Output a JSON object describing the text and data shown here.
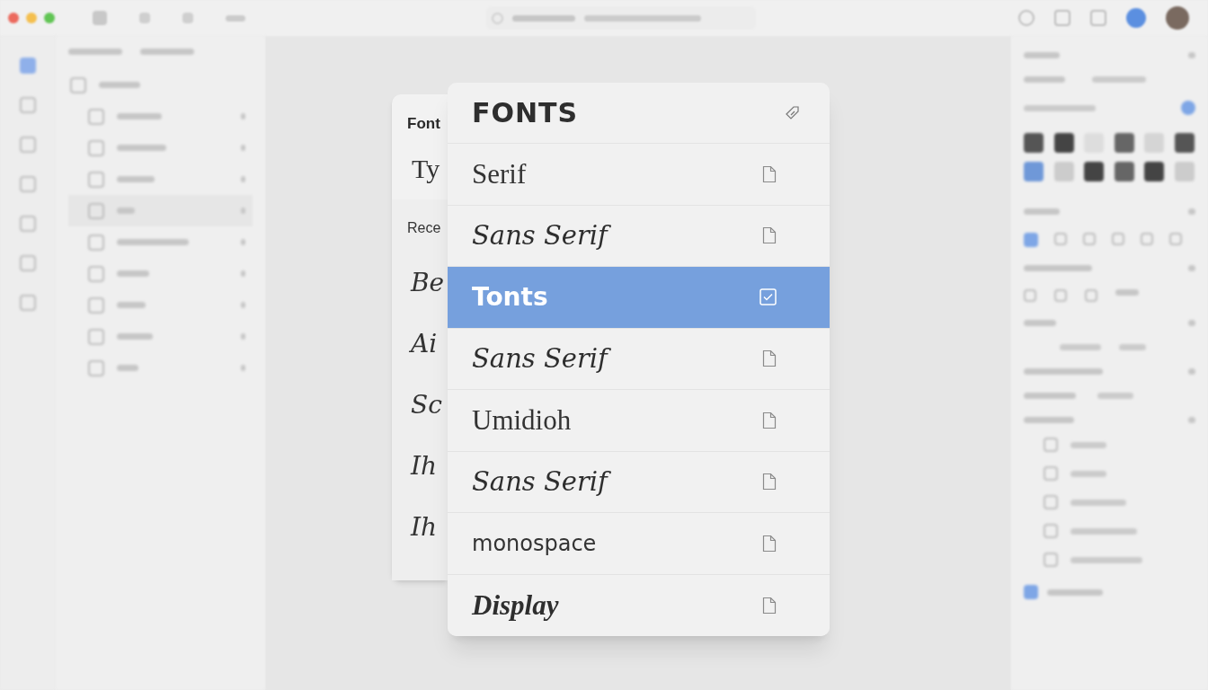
{
  "back_panel": {
    "title": "Font",
    "preview": "Ty",
    "section": "Rece",
    "samples": [
      "Be",
      "Ai",
      "Sc",
      "Ih",
      "Ih"
    ]
  },
  "font_menu": {
    "title": "FONTS",
    "items": [
      {
        "label": "Serif",
        "kind": "serif",
        "selected": false
      },
      {
        "label": "Sans Serif",
        "kind": "italic",
        "selected": false
      },
      {
        "label": "Tonts",
        "kind": "heavy",
        "selected": true
      },
      {
        "label": "Sans Serif",
        "kind": "italic",
        "selected": false
      },
      {
        "label": "Umidioh",
        "kind": "serif",
        "selected": false
      },
      {
        "label": "Sans Serif",
        "kind": "italic",
        "selected": false
      },
      {
        "label": "monospace",
        "kind": "plain",
        "selected": false
      },
      {
        "label": "Display",
        "kind": "display",
        "selected": false
      }
    ]
  }
}
